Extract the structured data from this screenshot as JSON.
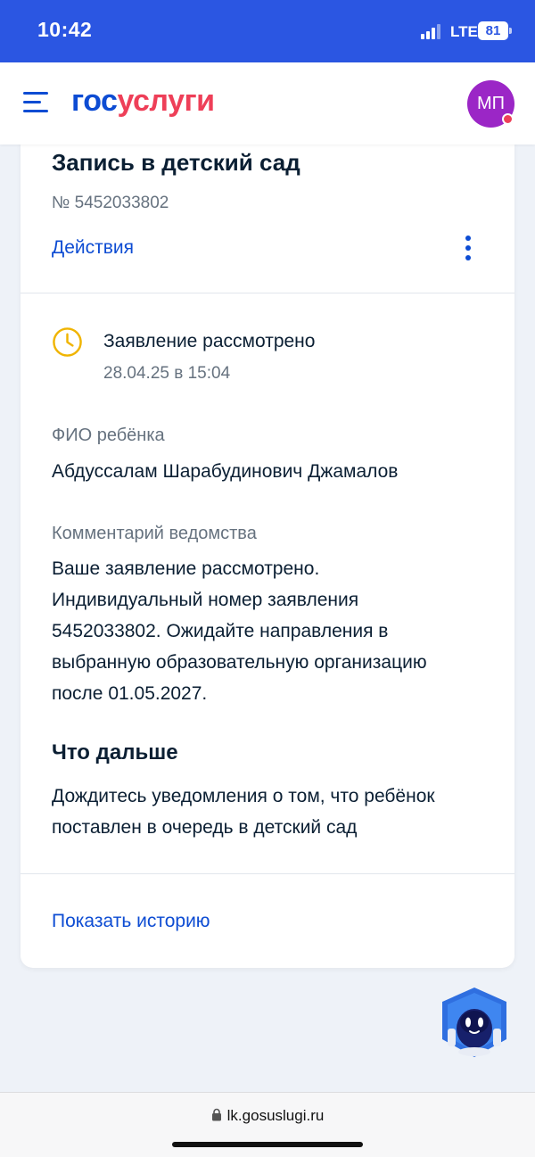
{
  "status_bar": {
    "time": "10:42",
    "network": "LTE",
    "battery": "81"
  },
  "header": {
    "logo_part1": "гос",
    "logo_part2": "услуги",
    "avatar_initials": "МП"
  },
  "card": {
    "title": "Запись в детский сад",
    "number": "№ 5452033802",
    "actions_label": "Действия",
    "status": {
      "text": "Заявление рассмотрено",
      "date": "28.04.25 в 15:04"
    },
    "child_label": "ФИО ребёнка",
    "child_name": "Абдуссалам Шарабудинович Джамалов",
    "comment_label": "Комментарий ведомства",
    "comment_lines": [
      "Ваше заявление рассмотрено.",
      "Индивидуальный номер заявления",
      "5452033802. Ожидайте направления в",
      "выбранную образовательную организацию",
      "после 01.05.2027."
    ],
    "next_title": "Что дальше",
    "next_lines": [
      "Дождитесь уведомления о том, что ребёнок",
      "поставлен в очередь в детский сад"
    ],
    "history_link": "Показать историю"
  },
  "browser": {
    "url": "lk.gosuslugi.ru"
  },
  "colors": {
    "status_bar": "#2b56e2",
    "link": "#0d4cd3",
    "logo_accent": "#ee3f58",
    "avatar": "#9b26c6",
    "status_icon": "#f0b400"
  }
}
